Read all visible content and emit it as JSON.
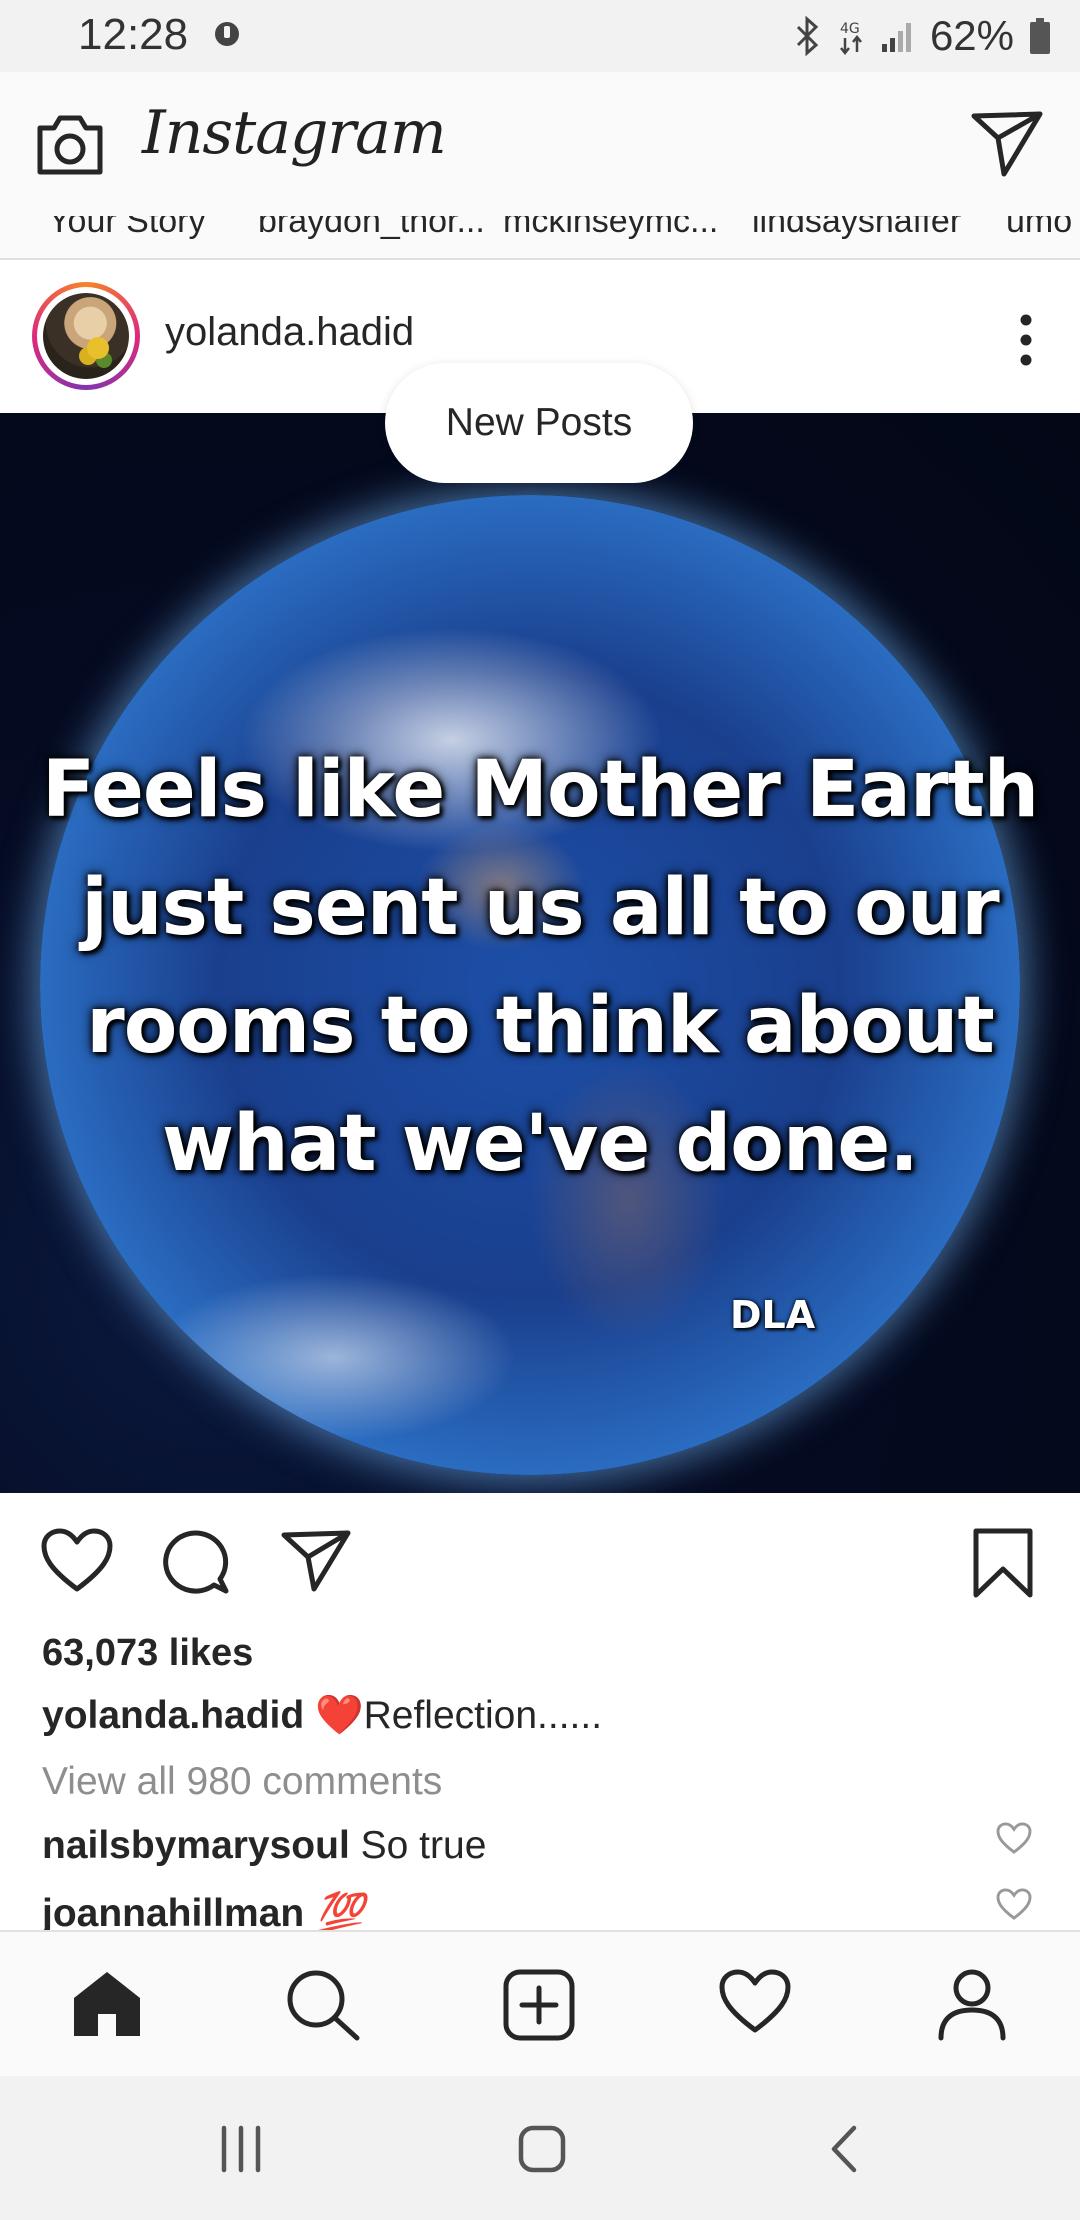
{
  "status_bar": {
    "time": "12:28",
    "battery_percent": "62%",
    "icons": [
      "dnd-icon",
      "bluetooth-icon",
      "data-4g-icon",
      "signal-icon",
      "battery-icon"
    ]
  },
  "app_bar": {
    "brand": "Instagram",
    "icons": [
      "camera-icon",
      "direct-message-icon"
    ]
  },
  "stories": {
    "labels": [
      "Your Story",
      "braydon_thor...",
      "mckinseymc...",
      "lindsayshaffer",
      "umo"
    ]
  },
  "post": {
    "username": "yolanda.hadid",
    "image_quote": [
      "Feels like Mother Earth",
      "just sent us all to our",
      "rooms to think about",
      "what we've done."
    ],
    "image_signature": "DLA",
    "likes": "63,073 likes",
    "caption_username": "yolanda.hadid",
    "caption_emoji": "❤️",
    "caption_text": "Reflection......",
    "view_comments": "View all 980 comments",
    "comments": [
      {
        "username": "nailsbymarysoul",
        "text": "So true"
      },
      {
        "username": "joannahillman",
        "text": "💯"
      }
    ]
  },
  "new_posts_label": "New Posts",
  "bottom_nav": [
    "home-icon",
    "search-icon",
    "add-post-icon",
    "activity-heart-icon",
    "profile-icon"
  ],
  "system_nav": [
    "recent-apps-icon",
    "home-button-icon",
    "back-icon"
  ],
  "colors": {
    "text": "#262626",
    "muted": "#8e8e8e",
    "bar_bg": "#fafafa",
    "status_bg": "#f2f2f2"
  }
}
